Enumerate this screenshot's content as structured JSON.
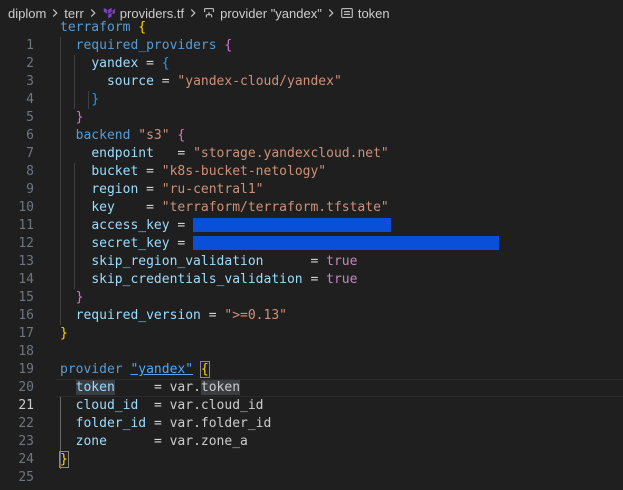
{
  "breadcrumb": {
    "items": [
      {
        "label": "diplom"
      },
      {
        "label": "terr"
      },
      {
        "label": "providers.tf"
      },
      {
        "label": "provider \"yandex\""
      },
      {
        "label": "token"
      }
    ]
  },
  "editor": {
    "active_line": "21",
    "line_numbers": [
      "1",
      "2",
      "3",
      "4",
      "5",
      "6",
      "7",
      "8",
      "9",
      "10",
      "11",
      "12",
      "13",
      "14",
      "15",
      "16",
      "17",
      "18",
      "19",
      "20",
      "21",
      "22",
      "23",
      "24",
      "25"
    ],
    "tokens": {
      "terraform": "terraform",
      "required_providers": "required_providers",
      "yandex": "yandex",
      "source": "source",
      "source_val": "\"yandex-cloud/yandex\"",
      "backend": "backend",
      "backend_name": "\"s3\"",
      "endpoint": "endpoint",
      "endpoint_val": "\"storage.yandexcloud.net\"",
      "bucket": "bucket",
      "bucket_val": "\"k8s-bucket-netology\"",
      "region": "region",
      "region_val": "\"ru-central1\"",
      "key": "key",
      "key_val": "\"terraform/terraform.tfstate\"",
      "access_key": "access_key",
      "secret_key": "secret_key",
      "skip_region_validation": "skip_region_validation",
      "skip_credentials_validation": "skip_credentials_validation",
      "true_val": "true",
      "required_version": "required_version",
      "required_version_val": "\">=0.13\"",
      "provider": "provider",
      "provider_name": "\"yandex\"",
      "token": "token",
      "var_token": "var.",
      "var_token_name": "token",
      "cloud_id": "cloud_id",
      "var_cloud_id": "var.cloud_id",
      "folder_id": "folder_id",
      "var_folder_id": "var.folder_id",
      "zone": "zone",
      "var_zone": "var.zone_a",
      "eq": "=",
      "lbrace": "{",
      "rbrace": "}"
    }
  },
  "colors": {
    "background": "#1f1f1f",
    "keyword": "#569cd6",
    "attribute": "#9cdcfe",
    "string": "#ce9178",
    "bool": "#c586c0",
    "redaction": "#0a4fd8",
    "terraform_icon": "#7b42bc"
  },
  "icons": {
    "separator": "chevron-right-icon",
    "file": "terraform-file-icon",
    "provider": "symbol-module-icon",
    "token": "symbol-field-icon"
  }
}
